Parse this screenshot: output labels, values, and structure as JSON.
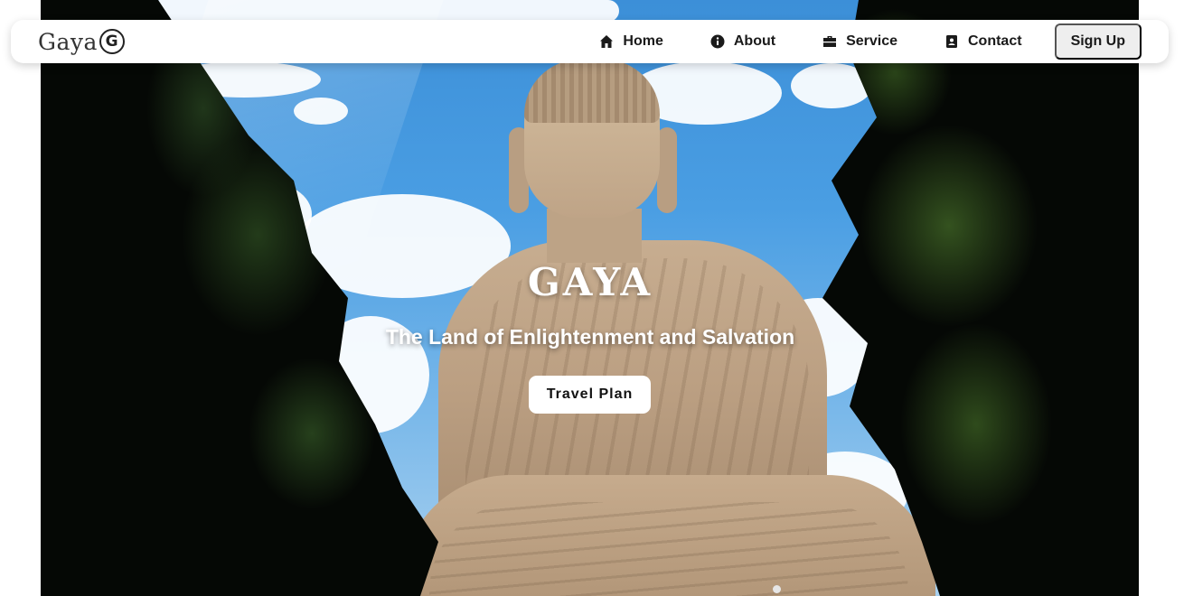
{
  "navbar": {
    "logo_text": "Gaya",
    "logo_mark": "G",
    "links": [
      {
        "label": "Home",
        "icon": "home-icon"
      },
      {
        "label": "About",
        "icon": "info-icon"
      },
      {
        "label": "Service",
        "icon": "briefcase-icon"
      },
      {
        "label": "Contact",
        "icon": "contact-card-icon"
      }
    ],
    "signup_label": "Sign Up"
  },
  "hero": {
    "title": "GAYA",
    "subtitle": "The Land of Enlightenment and Salvation",
    "cta_label": "Travel Plan"
  },
  "colors": {
    "navbar_bg": "#ffffff",
    "signup_bg": "#eeeeee",
    "text_dark": "#1a1a1a",
    "hero_text": "#ffffff",
    "sky": "#4a9ee3"
  }
}
